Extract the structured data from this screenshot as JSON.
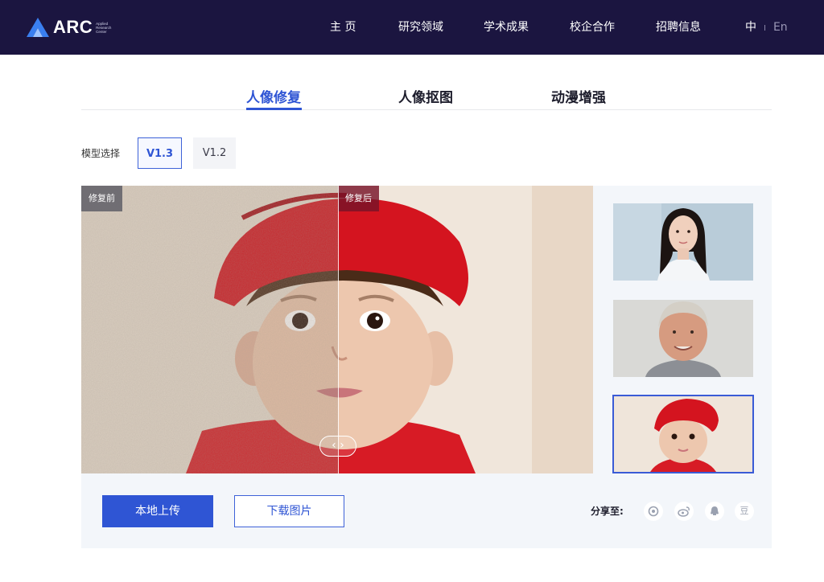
{
  "brand": {
    "name": "ARC",
    "subtitle_lines": [
      "Applied",
      "Research",
      "Center"
    ],
    "accent_color": "#2f6fe0"
  },
  "nav": {
    "items": [
      "主 页",
      "研究领域",
      "学术成果",
      "校企合作",
      "招聘信息"
    ],
    "lang_current": "中",
    "lang_separator": "I",
    "lang_alt": "En"
  },
  "tabs": {
    "items": [
      "人像修复",
      "人像抠图",
      "动漫增强"
    ],
    "active_index": 0
  },
  "model": {
    "label": "模型选择",
    "versions": [
      "V1.3",
      "V1.2"
    ],
    "selected": "V1.3"
  },
  "viewer": {
    "before_label": "修复前",
    "after_label": "修复后",
    "handle_icon": "chevron-left-right-icon"
  },
  "thumbnails": [
    {
      "name": "young-woman-portrait",
      "selected": false
    },
    {
      "name": "older-man-portrait",
      "selected": false
    },
    {
      "name": "child-red-hat-portrait",
      "selected": true
    }
  ],
  "actions": {
    "upload_label": "本地上传",
    "download_label": "下载图片"
  },
  "share": {
    "label": "分享至:",
    "icons": [
      "wechat-moments-icon",
      "weibo-icon",
      "qq-icon",
      "douban-icon"
    ],
    "douban_glyph": "豆"
  },
  "colors": {
    "header_bg": "#1b1540",
    "primary": "#2f55d4",
    "panel_bg": "#f3f6fa"
  }
}
